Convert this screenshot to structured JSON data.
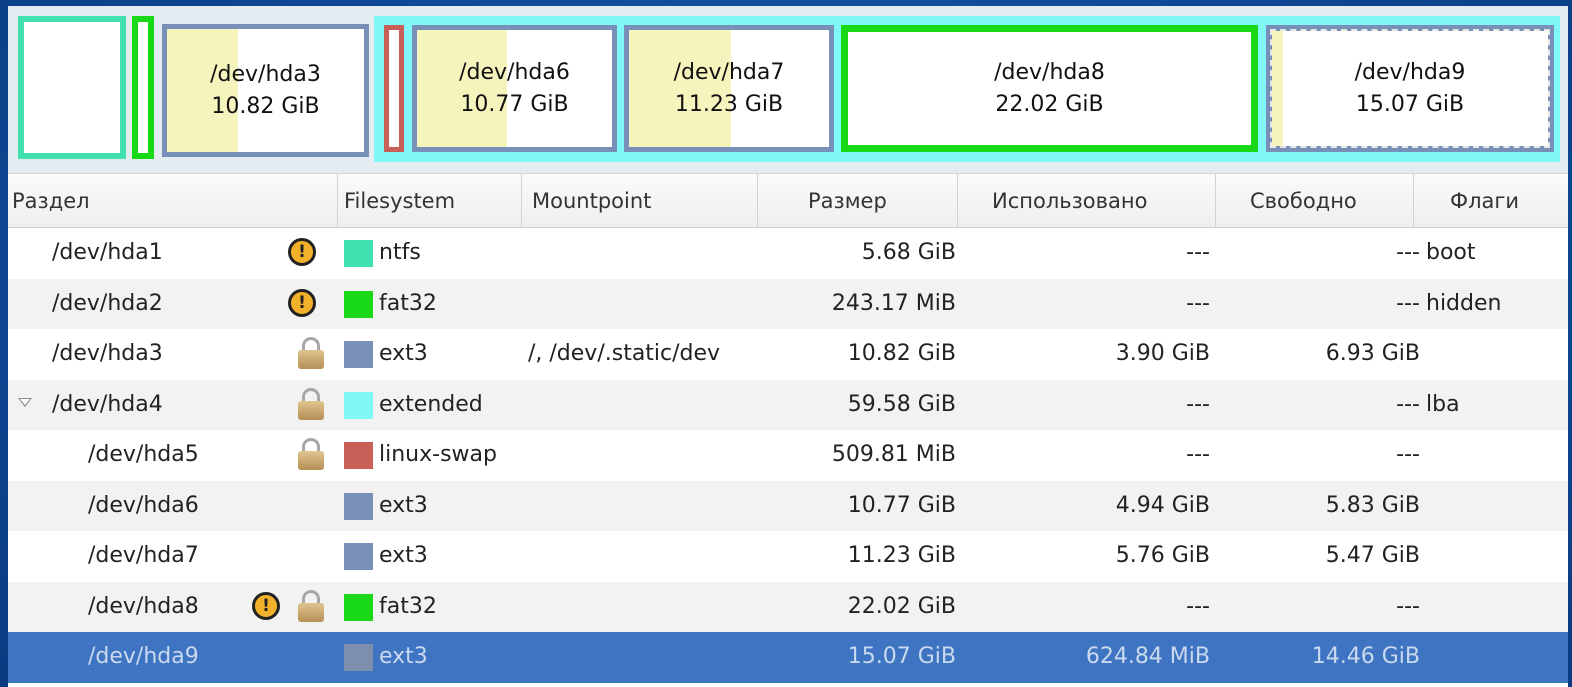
{
  "partition_map": {
    "blocks": [
      {
        "name": "/dev/hda3",
        "size": "10.82 GiB"
      },
      {
        "name": "/dev/hda6",
        "size": "10.77 GiB"
      },
      {
        "name": "/dev/hda7",
        "size": "11.23 GiB"
      },
      {
        "name": "/dev/hda8",
        "size": "22.02 GiB"
      },
      {
        "name": "/dev/hda9",
        "size": "15.07 GiB"
      }
    ]
  },
  "table": {
    "headers": {
      "partition": "Раздел",
      "filesystem": "Filesystem",
      "mountpoint": "Mountpoint",
      "size": "Размер",
      "used": "Использовано",
      "free": "Свободно",
      "flags": "Флаги"
    },
    "rows": [
      {
        "partition": "/dev/hda1",
        "filesystem": "ntfs",
        "fs_color": "#40e0b0",
        "mountpoint": "",
        "size": "5.68 GiB",
        "used": "---",
        "free": "---",
        "flags": "boot",
        "icons": [
          "warning-icon"
        ]
      },
      {
        "partition": "/dev/hda2",
        "filesystem": "fat32",
        "fs_color": "#18d818",
        "mountpoint": "",
        "size": "243.17 MiB",
        "used": "---",
        "free": "---",
        "flags": "hidden",
        "icons": [
          "warning-icon"
        ]
      },
      {
        "partition": "/dev/hda3",
        "filesystem": "ext3",
        "fs_color": "#7890b8",
        "mountpoint": "/, /dev/.static/dev",
        "size": "10.82 GiB",
        "used": "3.90 GiB",
        "free": "6.93 GiB",
        "flags": "",
        "icons": [
          "lock-icon"
        ]
      },
      {
        "partition": "/dev/hda4",
        "filesystem": "extended",
        "fs_color": "#80f8f8",
        "mountpoint": "",
        "size": "59.58 GiB",
        "used": "---",
        "free": "---",
        "flags": "lba",
        "icons": [
          "lock-icon"
        ]
      },
      {
        "partition": "/dev/hda5",
        "filesystem": "linux-swap",
        "fs_color": "#c86058",
        "mountpoint": "",
        "size": "509.81 MiB",
        "used": "---",
        "free": "---",
        "flags": "",
        "icons": [
          "lock-icon"
        ]
      },
      {
        "partition": "/dev/hda6",
        "filesystem": "ext3",
        "fs_color": "#7890b8",
        "mountpoint": "",
        "size": "10.77 GiB",
        "used": "4.94 GiB",
        "free": "5.83 GiB",
        "flags": "",
        "icons": []
      },
      {
        "partition": "/dev/hda7",
        "filesystem": "ext3",
        "fs_color": "#7890b8",
        "mountpoint": "",
        "size": "11.23 GiB",
        "used": "5.76 GiB",
        "free": "5.47 GiB",
        "flags": "",
        "icons": []
      },
      {
        "partition": "/dev/hda8",
        "filesystem": "fat32",
        "fs_color": "#18d818",
        "mountpoint": "",
        "size": "22.02 GiB",
        "used": "---",
        "free": "---",
        "flags": "",
        "icons": [
          "warning-icon",
          "lock-icon"
        ]
      },
      {
        "partition": "/dev/hda9",
        "filesystem": "ext3",
        "fs_color": "#7890b8",
        "mountpoint": "",
        "size": "15.07 GiB",
        "used": "624.84 MiB",
        "free": "14.46 GiB",
        "flags": "",
        "icons": [],
        "selected": true
      }
    ]
  },
  "colors": {
    "ntfs": "#40e0b0",
    "fat32": "#18d818",
    "ext3": "#7890b8",
    "extended": "#80f8f8",
    "linux_swap": "#c86058",
    "used_space": "#f6f4bd",
    "selection": "#3e74c1"
  }
}
